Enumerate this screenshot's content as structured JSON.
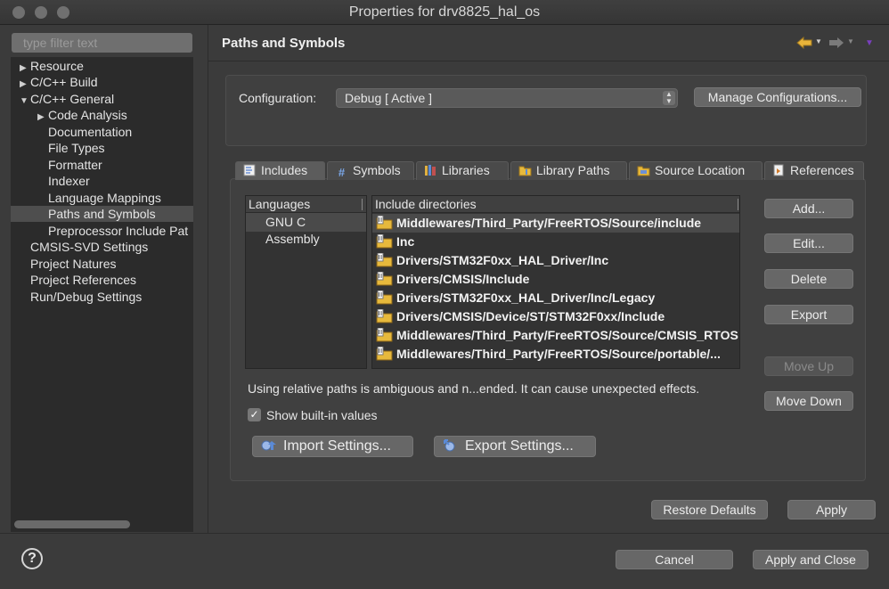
{
  "window": {
    "title": "Properties for drv8825_hal_os"
  },
  "filter": {
    "placeholder": "type filter text"
  },
  "tree": [
    {
      "label": "Resource",
      "arrow": "▶"
    },
    {
      "label": "C/C++ Build",
      "arrow": "▶"
    },
    {
      "label": "C/C++ General",
      "arrow": "▼"
    },
    {
      "label": "Code Analysis",
      "arrow": "▶"
    },
    {
      "label": "Documentation",
      "arrow": ""
    },
    {
      "label": "File Types",
      "arrow": ""
    },
    {
      "label": "Formatter",
      "arrow": ""
    },
    {
      "label": "Indexer",
      "arrow": ""
    },
    {
      "label": "Language Mappings",
      "arrow": ""
    },
    {
      "label": "Paths and Symbols",
      "arrow": "",
      "selected": true
    },
    {
      "label": "Preprocessor Include Pat",
      "arrow": ""
    },
    {
      "label": "CMSIS-SVD Settings",
      "arrow": ""
    },
    {
      "label": "Project Natures",
      "arrow": ""
    },
    {
      "label": "Project References",
      "arrow": ""
    },
    {
      "label": "Run/Debug Settings",
      "arrow": ""
    }
  ],
  "header": {
    "title": "Paths and Symbols"
  },
  "config": {
    "label": "Configuration:",
    "value": "Debug  [ Active ]",
    "manage_label": "Manage Configurations..."
  },
  "tabs": [
    {
      "label": "Includes",
      "icon": "includes-icon",
      "active": true
    },
    {
      "label": "Symbols",
      "icon": "symbols-icon"
    },
    {
      "label": "Libraries",
      "icon": "libraries-icon"
    },
    {
      "label": "Library Paths",
      "icon": "library-paths-icon"
    },
    {
      "label": "Source Location",
      "icon": "source-location-icon"
    },
    {
      "label": "References",
      "icon": "references-icon"
    }
  ],
  "languages": {
    "header": "Languages",
    "items": [
      "GNU C",
      "Assembly"
    ]
  },
  "includes": {
    "header": "Include directories",
    "items": [
      "Middlewares/Third_Party/FreeRTOS/Source/include",
      "Inc",
      "Drivers/STM32F0xx_HAL_Driver/Inc",
      "Drivers/CMSIS/Include",
      "Drivers/STM32F0xx_HAL_Driver/Inc/Legacy",
      "Drivers/CMSIS/Device/ST/STM32F0xx/Include",
      "Middlewares/Third_Party/FreeRTOS/Source/CMSIS_RTOS",
      "Middlewares/Third_Party/FreeRTOS/Source/portable/..."
    ]
  },
  "side_buttons": {
    "add": "Add...",
    "edit": "Edit...",
    "delete": "Delete",
    "export": "Export",
    "move_up": "Move Up",
    "move_down": "Move Down"
  },
  "warning": "Using relative paths is ambiguous and n...ended. It can cause unexpected effects.",
  "show_builtin": {
    "label": "Show built-in values",
    "checked": true
  },
  "import_settings": "Import Settings...",
  "export_settings": "Export Settings...",
  "restore_defaults": "Restore Defaults",
  "apply": "Apply",
  "cancel": "Cancel",
  "apply_and_close": "Apply and Close",
  "help": "?",
  "colors": {
    "background": "#3b3b3b",
    "folder_yellow": "#e7b93c",
    "nav_back": "#e8b43a",
    "nav_menu": "#7a3fbf"
  }
}
